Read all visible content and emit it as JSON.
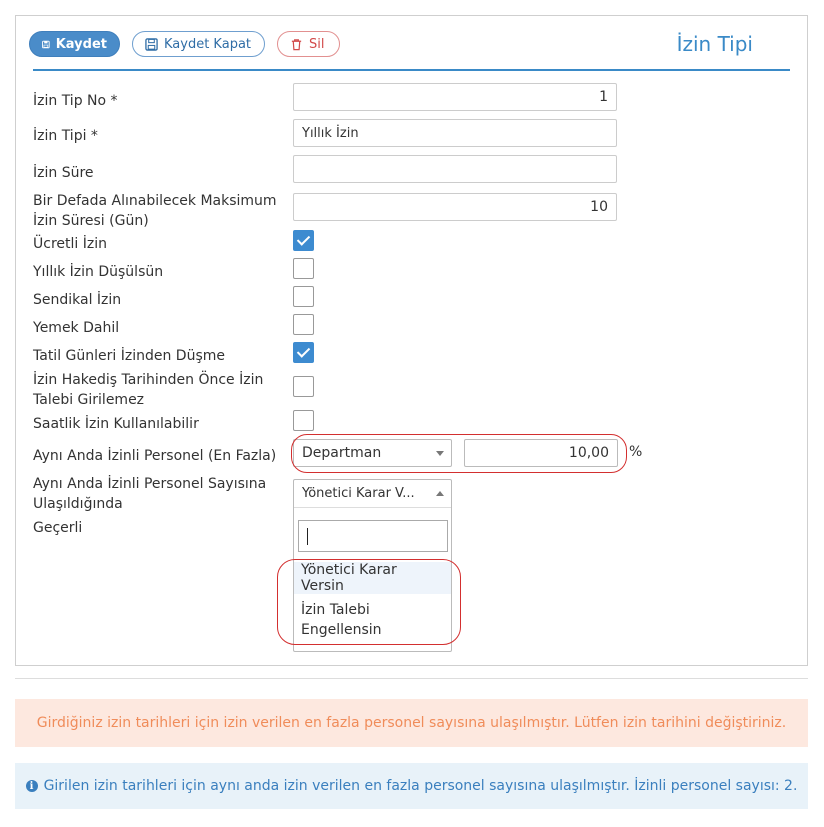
{
  "toolbar": {
    "save_label": "Kaydet",
    "save_close_label": "Kaydet Kapat",
    "delete_label": "Sil"
  },
  "page_title": "İzin Tipi",
  "form": {
    "izin_tip_no": {
      "label": "İzin Tip No *",
      "value": "1"
    },
    "izin_tipi": {
      "label": "İzin Tipi *",
      "value": "Yıllık İzin"
    },
    "izin_sure": {
      "label": "İzin Süre",
      "value": ""
    },
    "max_sure": {
      "label_line1": "Bir Defada Alınabilecek Maksimum",
      "label_line2": "İzin Süresi (Gün)",
      "value": "10"
    },
    "ucretli": {
      "label": "Ücretli İzin",
      "checked": true
    },
    "yillik_dusulsun": {
      "label": "Yıllık İzin Düşülsün",
      "checked": false
    },
    "sendikal": {
      "label": "Sendikal İzin",
      "checked": false
    },
    "yemek": {
      "label": "Yemek Dahil",
      "checked": false
    },
    "tatil": {
      "label": "Tatil Günleri İzinden Düşme",
      "checked": true
    },
    "hakedis": {
      "label_line1": "İzin Hakediş Tarihinden Önce İzin",
      "label_line2": "Talebi Girilemez",
      "checked": false
    },
    "saatlik": {
      "label": "Saatlik İzin Kullanılabilir",
      "checked": false
    },
    "ayni_anda": {
      "label": "Aynı Anda İzinli Personel (En Fazla)",
      "select_value": "Departman",
      "number_value": "10,00",
      "unit": "%"
    },
    "ulasildiginda": {
      "label_line1": "Aynı Anda İzinli Personel Sayısına",
      "label_line2": "Ulaşıldığında",
      "selected": "Yönetici Karar V...",
      "search_value": "",
      "options": [
        "Yönetici Karar Versin",
        "İzin Talebi Engellensin"
      ],
      "option2_line1": "İzin Talebi",
      "option2_line2": "Engellensin"
    },
    "gecerli": {
      "label": "Geçerli"
    }
  },
  "alerts": {
    "warning": "Girdiğiniz izin tarihleri için izin verilen en fazla personel sayısına ulaşılmıştır. Lütfen izin tarihini değiştiriniz.",
    "info": "Girilen izin tarihleri için aynı anda izin verilen en fazla personel sayısına ulaşılmıştır. İzinli personel sayısı: 2."
  },
  "colors": {
    "accent": "#3a8ac7",
    "save_button": "#4a8cc9",
    "delete": "#d24a4a",
    "checkbox_on": "#3d8bd0",
    "highlight_oval": "#d32f2f",
    "warning_bg": "#fde8df",
    "warning_text": "#f08c5a",
    "info_bg": "#e8f2f9",
    "info_text": "#3a7fbe"
  },
  "icons": {
    "save": "save-icon",
    "save_close": "save-icon",
    "delete": "trash-icon",
    "info": "info-circle-icon"
  }
}
